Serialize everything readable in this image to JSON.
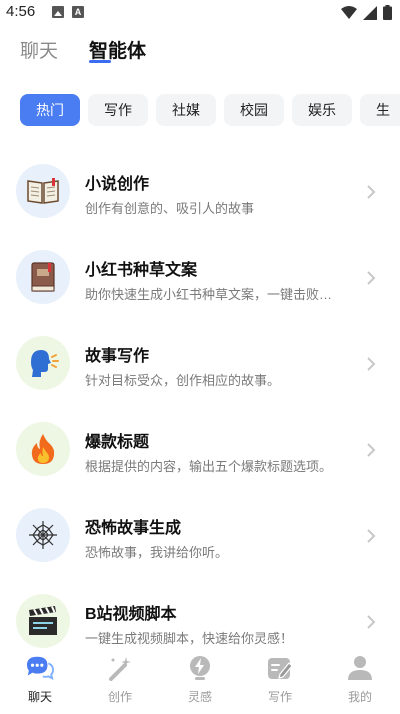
{
  "status_bar": {
    "time": "4:56"
  },
  "header": {
    "tabs": [
      {
        "label": "聊天"
      },
      {
        "label": "智能体"
      }
    ],
    "active_tab": "智能体"
  },
  "categories": {
    "chips": [
      {
        "label": "热门"
      },
      {
        "label": "写作"
      },
      {
        "label": "社媒"
      },
      {
        "label": "校园"
      },
      {
        "label": "娱乐"
      },
      {
        "label": "生"
      }
    ],
    "active": "热门"
  },
  "agents": [
    {
      "title": "小说创作",
      "desc": "创作有创意的、吸引人的故事",
      "icon": "open-book-icon",
      "bg": "#e8f0fb"
    },
    {
      "title": "小红书种草文案",
      "desc": "助你快速生成小红书种草文案，一键击败…",
      "icon": "closed-book-icon",
      "bg": "#e8f0fb"
    },
    {
      "title": "故事写作",
      "desc": "针对目标受众，创作相应的故事。",
      "icon": "speaking-head-icon",
      "bg": "#eef7e3"
    },
    {
      "title": "爆款标题",
      "desc": "根据提供的内容，输出五个爆款标题选项。",
      "icon": "fire-icon",
      "bg": "#eef7e3"
    },
    {
      "title": "恐怖故事生成",
      "desc": "恐怖故事，我讲给你听。",
      "icon": "spider-web-icon",
      "bg": "#e8f0fb"
    },
    {
      "title": "B站视频脚本",
      "desc": "一键生成视频脚本，快速给你灵感！",
      "icon": "clapperboard-icon",
      "bg": "#eef7e3"
    }
  ],
  "bottom_nav": {
    "items": [
      {
        "label": "聊天",
        "icon": "chat-bubble-icon"
      },
      {
        "label": "创作",
        "icon": "magic-wand-icon"
      },
      {
        "label": "灵感",
        "icon": "lightning-icon"
      },
      {
        "label": "写作",
        "icon": "pen-note-icon"
      },
      {
        "label": "我的",
        "icon": "person-icon"
      }
    ],
    "active": "聊天"
  },
  "colors": {
    "accent": "#4a7cf2",
    "chip_bg": "#f3f4f6",
    "muted": "#7a7a7a"
  }
}
